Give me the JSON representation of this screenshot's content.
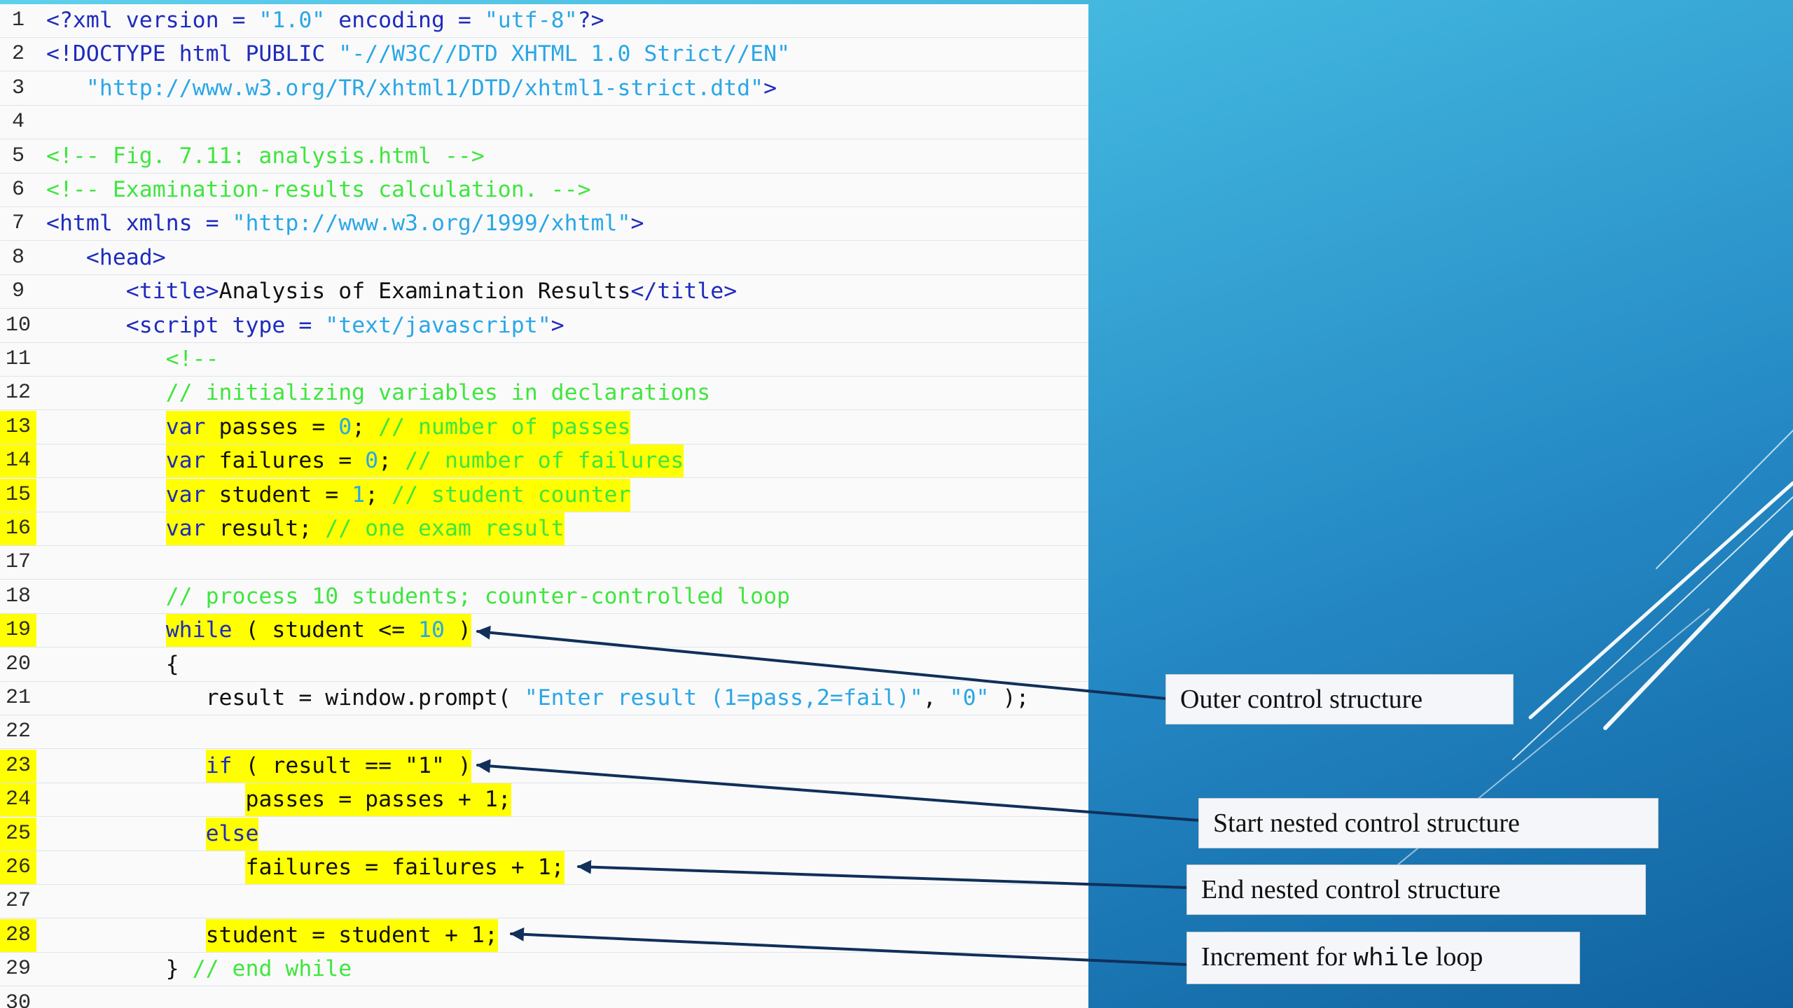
{
  "colors": {
    "tag": "#1f2bbd",
    "string": "#2aa7e6",
    "comment": "#3ee63e",
    "plain": "#111111",
    "highlight": "#ffff00",
    "arrow": "#10305a"
  },
  "code_lines": [
    {
      "n": "1",
      "hl": false,
      "tokens": [
        {
          "c": "t-c",
          "t": "<?xml version = "
        },
        {
          "c": "t-s",
          "t": "\"1.0\""
        },
        {
          "c": "t-c",
          "t": " encoding = "
        },
        {
          "c": "t-s",
          "t": "\"utf-8\""
        },
        {
          "c": "t-c",
          "t": "?>"
        }
      ]
    },
    {
      "n": "2",
      "hl": false,
      "tokens": [
        {
          "c": "t-c",
          "t": "<!DOCTYPE html PUBLIC "
        },
        {
          "c": "t-s",
          "t": "\"-//W3C//DTD XHTML 1.0 Strict//EN\""
        }
      ]
    },
    {
      "n": "3",
      "hl": false,
      "tokens": [
        {
          "c": "t-c",
          "t": "   "
        },
        {
          "c": "t-s",
          "t": "\"http://www.w3.org/TR/xhtml1/DTD/xhtml1-strict.dtd\""
        },
        {
          "c": "t-c",
          "t": ">"
        }
      ]
    },
    {
      "n": "4",
      "hl": false,
      "tokens": []
    },
    {
      "n": "5",
      "hl": false,
      "tokens": [
        {
          "c": "t-cm",
          "t": "<!-- Fig. 7.11: analysis.html -->"
        }
      ]
    },
    {
      "n": "6",
      "hl": false,
      "tokens": [
        {
          "c": "t-cm",
          "t": "<!-- Examination-results calculation. -->"
        }
      ]
    },
    {
      "n": "7",
      "hl": false,
      "tokens": [
        {
          "c": "t-c",
          "t": "<html xmlns = "
        },
        {
          "c": "t-s",
          "t": "\"http://www.w3.org/1999/xhtml\""
        },
        {
          "c": "t-c",
          "t": ">"
        }
      ]
    },
    {
      "n": "8",
      "hl": false,
      "tokens": [
        {
          "c": "t-c",
          "t": "   <head>"
        }
      ]
    },
    {
      "n": "9",
      "hl": false,
      "tokens": [
        {
          "c": "t-c",
          "t": "      <title>"
        },
        {
          "c": "t-p",
          "t": "Analysis of Examination Results"
        },
        {
          "c": "t-c",
          "t": "</title>"
        }
      ]
    },
    {
      "n": "10",
      "hl": false,
      "tokens": [
        {
          "c": "t-c",
          "t": "      <script type = "
        },
        {
          "c": "t-s",
          "t": "\"text/javascript\""
        },
        {
          "c": "t-c",
          "t": ">"
        }
      ]
    },
    {
      "n": "11",
      "hl": false,
      "tokens": [
        {
          "c": "t-cm",
          "t": "         <!--"
        }
      ]
    },
    {
      "n": "12",
      "hl": false,
      "tokens": [
        {
          "c": "t-cm",
          "t": "         // initializing variables in declarations"
        }
      ]
    },
    {
      "n": "13",
      "hl": true,
      "tokens": [
        {
          "c": "t-c",
          "t": "         var "
        },
        {
          "c": "t-p",
          "t": "passes = "
        },
        {
          "c": "t-n",
          "t": "0"
        },
        {
          "c": "t-p",
          "t": "; "
        },
        {
          "c": "t-cm",
          "t": "// number of passes"
        }
      ]
    },
    {
      "n": "14",
      "hl": true,
      "tokens": [
        {
          "c": "t-c",
          "t": "         var "
        },
        {
          "c": "t-p",
          "t": "failures = "
        },
        {
          "c": "t-n",
          "t": "0"
        },
        {
          "c": "t-p",
          "t": "; "
        },
        {
          "c": "t-cm",
          "t": "// number of failures"
        }
      ]
    },
    {
      "n": "15",
      "hl": true,
      "tokens": [
        {
          "c": "t-c",
          "t": "         var "
        },
        {
          "c": "t-p",
          "t": "student = "
        },
        {
          "c": "t-n",
          "t": "1"
        },
        {
          "c": "t-p",
          "t": "; "
        },
        {
          "c": "t-cm",
          "t": "// student counter"
        }
      ]
    },
    {
      "n": "16",
      "hl": true,
      "tokens": [
        {
          "c": "t-c",
          "t": "         var "
        },
        {
          "c": "t-p",
          "t": "result; "
        },
        {
          "c": "t-cm",
          "t": "// one exam result"
        }
      ]
    },
    {
      "n": "17",
      "hl": false,
      "tokens": []
    },
    {
      "n": "18",
      "hl": false,
      "tokens": [
        {
          "c": "t-cm",
          "t": "         // process 10 students; counter-controlled loop"
        }
      ]
    },
    {
      "n": "19",
      "hl": true,
      "tokens": [
        {
          "c": "t-c",
          "t": "         while "
        },
        {
          "c": "t-p",
          "t": "( student <= "
        },
        {
          "c": "t-n",
          "t": "10"
        },
        {
          "c": "t-p",
          "t": " )"
        }
      ]
    },
    {
      "n": "20",
      "hl": false,
      "tokens": [
        {
          "c": "t-p",
          "t": "         {"
        }
      ]
    },
    {
      "n": "21",
      "hl": false,
      "tokens": [
        {
          "c": "t-p",
          "t": "            result = window.prompt( "
        },
        {
          "c": "t-s",
          "t": "\"Enter result (1=pass,2=fail)\""
        },
        {
          "c": "t-p",
          "t": ", "
        },
        {
          "c": "t-s",
          "t": "\"0\""
        },
        {
          "c": "t-p",
          "t": " );"
        }
      ]
    },
    {
      "n": "22",
      "hl": false,
      "tokens": []
    },
    {
      "n": "23",
      "hl": true,
      "tokens": [
        {
          "c": "t-c",
          "t": "            if "
        },
        {
          "c": "t-p",
          "t": "( result == \"1\" )"
        }
      ]
    },
    {
      "n": "24",
      "hl": true,
      "tokens": [
        {
          "c": "t-p",
          "t": "               passes = passes + 1;"
        }
      ]
    },
    {
      "n": "25",
      "hl": true,
      "tokens": [
        {
          "c": "t-c",
          "t": "            else"
        }
      ]
    },
    {
      "n": "26",
      "hl": true,
      "tokens": [
        {
          "c": "t-p",
          "t": "               failures = failures + 1;"
        }
      ]
    },
    {
      "n": "27",
      "hl": false,
      "tokens": []
    },
    {
      "n": "28",
      "hl": true,
      "tokens": [
        {
          "c": "t-p",
          "t": "            student = student + 1;"
        }
      ]
    },
    {
      "n": "29",
      "hl": false,
      "tokens": [
        {
          "c": "t-p",
          "t": "         } "
        },
        {
          "c": "t-cm",
          "t": "// end while"
        }
      ]
    },
    {
      "n": "30",
      "hl": false,
      "tokens": []
    }
  ],
  "callouts": {
    "outer": "Outer control structure",
    "start_nested": "Start nested control structure",
    "end_nested": "End nested control structure",
    "increment_prefix": "Increment for ",
    "increment_keyword": "while",
    "increment_suffix": " loop"
  }
}
